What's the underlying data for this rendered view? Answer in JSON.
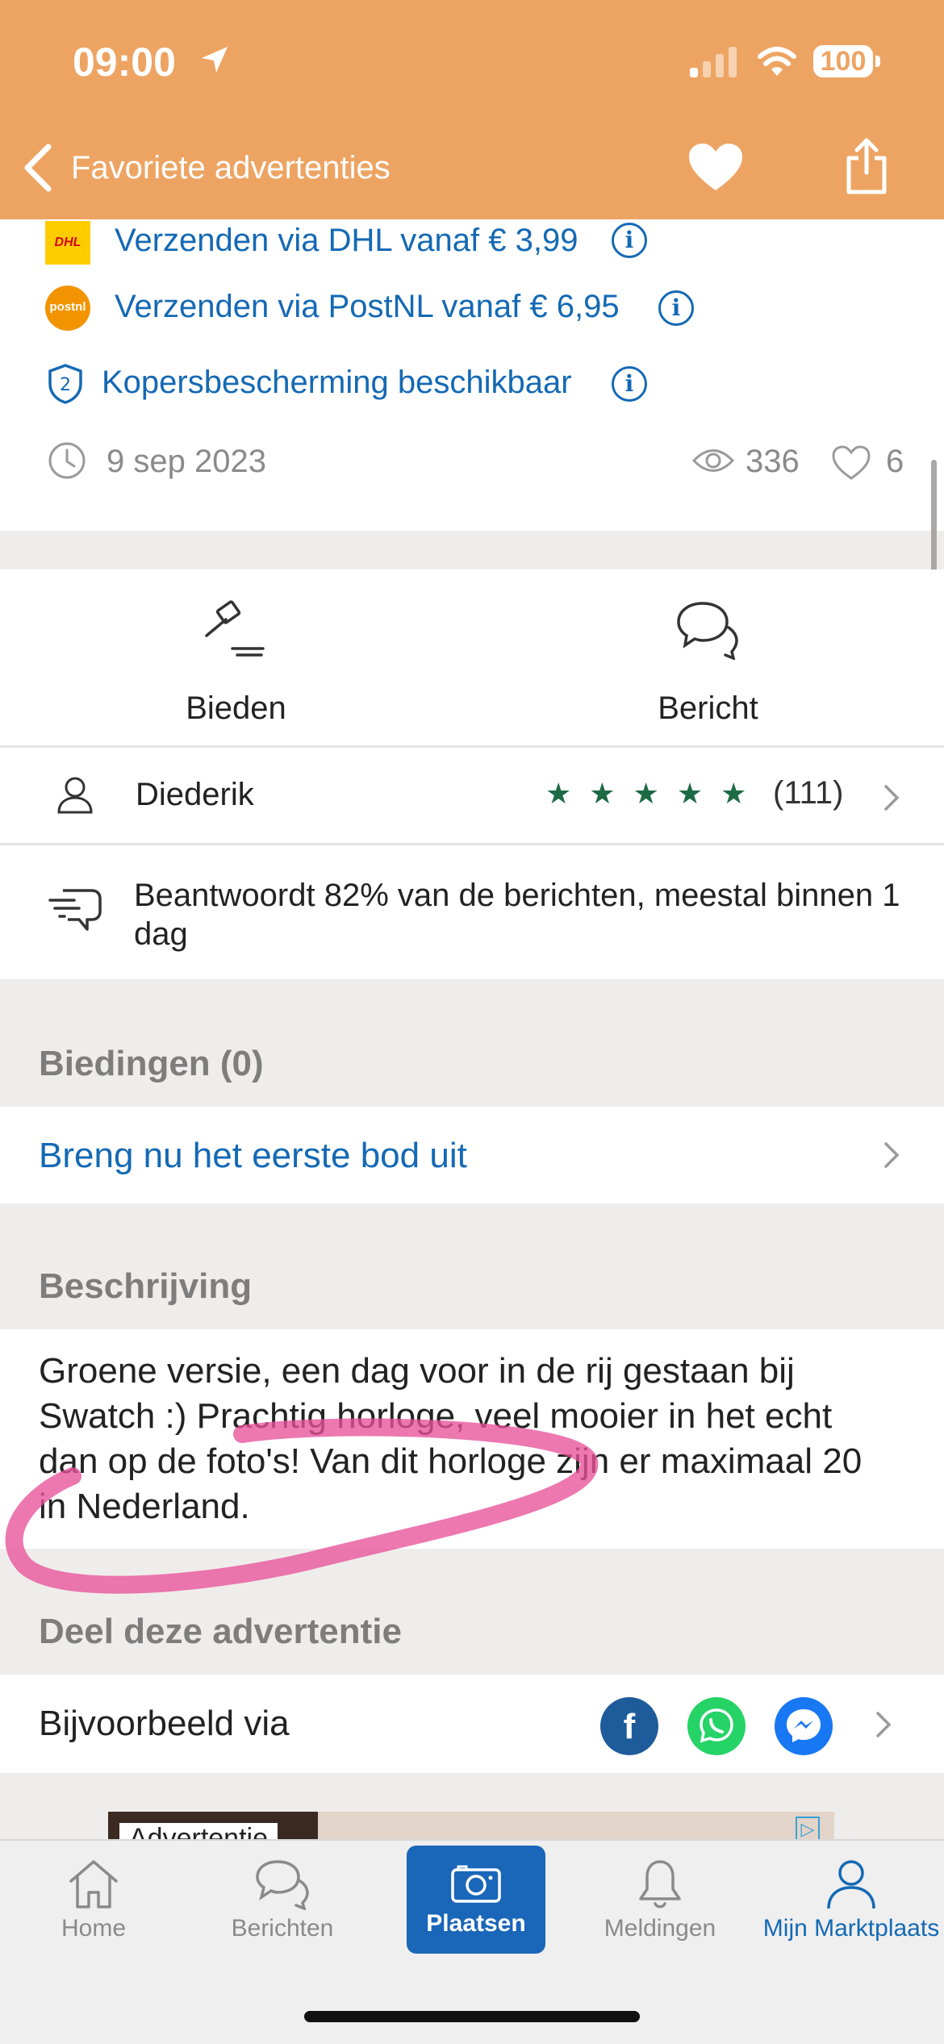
{
  "status_bar": {
    "time": "09:00",
    "battery": "100"
  },
  "nav": {
    "title": "Favoriete advertenties"
  },
  "shipping": [
    {
      "label": "Verzenden via DHL vanaf € 3,99",
      "logo": "DHL"
    },
    {
      "label": "Verzenden via PostNL vanaf € 6,95",
      "logo": "postnl"
    }
  ],
  "protection": {
    "label": "Kopersbescherming beschikbaar"
  },
  "meta": {
    "date": "9 sep 2023",
    "views": "336",
    "favorites": "6"
  },
  "actions": {
    "bid_label": "Bieden",
    "message_label": "Bericht"
  },
  "seller": {
    "name": "Diederik",
    "rating_count": "(111)",
    "stars": 5,
    "star_color": "#1d6b45"
  },
  "response": {
    "text": "Beantwoordt 82% van de berichten, meestal binnen 1 dag"
  },
  "bids": {
    "title": "Biedingen (0)",
    "cta": "Breng nu het eerste bod uit"
  },
  "description": {
    "title": "Beschrijving",
    "text": "Groene versie, een dag voor in de rij gestaan bij Swatch :) Prachtig horloge, veel mooier in het echt dan op de foto's! Van dit horloge zijn er maximaal 20 in Nederland."
  },
  "share": {
    "title": "Deel deze advertentie",
    "label": "Bijvoorbeeld via"
  },
  "ad": {
    "label": "Advertentie"
  },
  "tabs": [
    {
      "label": "Home",
      "icon": "home-icon"
    },
    {
      "label": "Berichten",
      "icon": "chat-icon"
    },
    {
      "label": "Plaatsen",
      "icon": "camera-icon"
    },
    {
      "label": "Meldingen",
      "icon": "bell-icon"
    },
    {
      "label": "Mijn Marktplaats",
      "icon": "user-icon"
    }
  ],
  "colors": {
    "header": "#eda463",
    "link": "#1469b4",
    "plaatsen_bg": "#1a66b8",
    "annotation": "#e8529a"
  }
}
